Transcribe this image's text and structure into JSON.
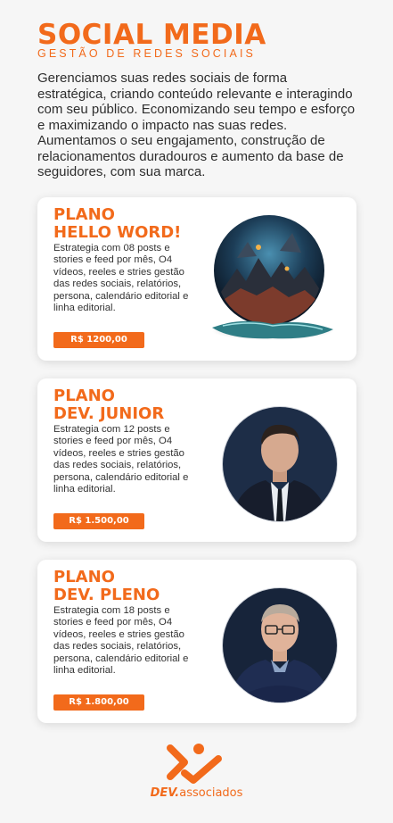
{
  "header": {
    "title": "SOCIAL MEDIA",
    "subtitle": "GESTÃO DE REDES SOCIAIS"
  },
  "intro": "Gerenciamos suas redes sociais de forma estratégica, criando conteúdo relevante e interagindo com seu público. Economizando seu tempo e esforço e maximizando o impacto nas suas redes. Aumentamos o seu engajamento, construção de relacionamentos duradouros e aumento da base de seguidores, com sua marca.",
  "plans": [
    {
      "title_line1": "PLANO",
      "title_line2": "HELLO WORD!",
      "description": "Estrategia com 08 posts e stories e feed por mês, O4 vídeos, reeles e stries gestão das redes sociais, relatórios, persona, calendário editorial e linha editorial.",
      "price": "R$ 1200,00",
      "image": "fantasy-globe-illustration"
    },
    {
      "title_line1": "PLANO",
      "title_line2": "DEV. JUNIOR",
      "description": "Estrategia com 12 posts e stories e feed por mês, O4 vídeos, reeles e stries gestão das redes sociais, relatórios, persona, calendário editorial e linha editorial.",
      "price": "R$ 1.500,00",
      "image": "portrait-man-suit"
    },
    {
      "title_line1": "PLANO",
      "title_line2": "DEV. PLENO",
      "description": "Estrategia com 18 posts e stories e feed por mês, O4 vídeos, reeles e stries gestão das redes sociais, relatórios, persona, calendário editorial e linha editorial.",
      "price": "R$ 1.800,00",
      "image": "portrait-man-glasses"
    }
  ],
  "logo": {
    "brand_bold": "DEV.",
    "brand_rest": "associados"
  },
  "colors": {
    "accent": "#f26a1b",
    "background": "#f6f6f6",
    "card": "#ffffff"
  }
}
